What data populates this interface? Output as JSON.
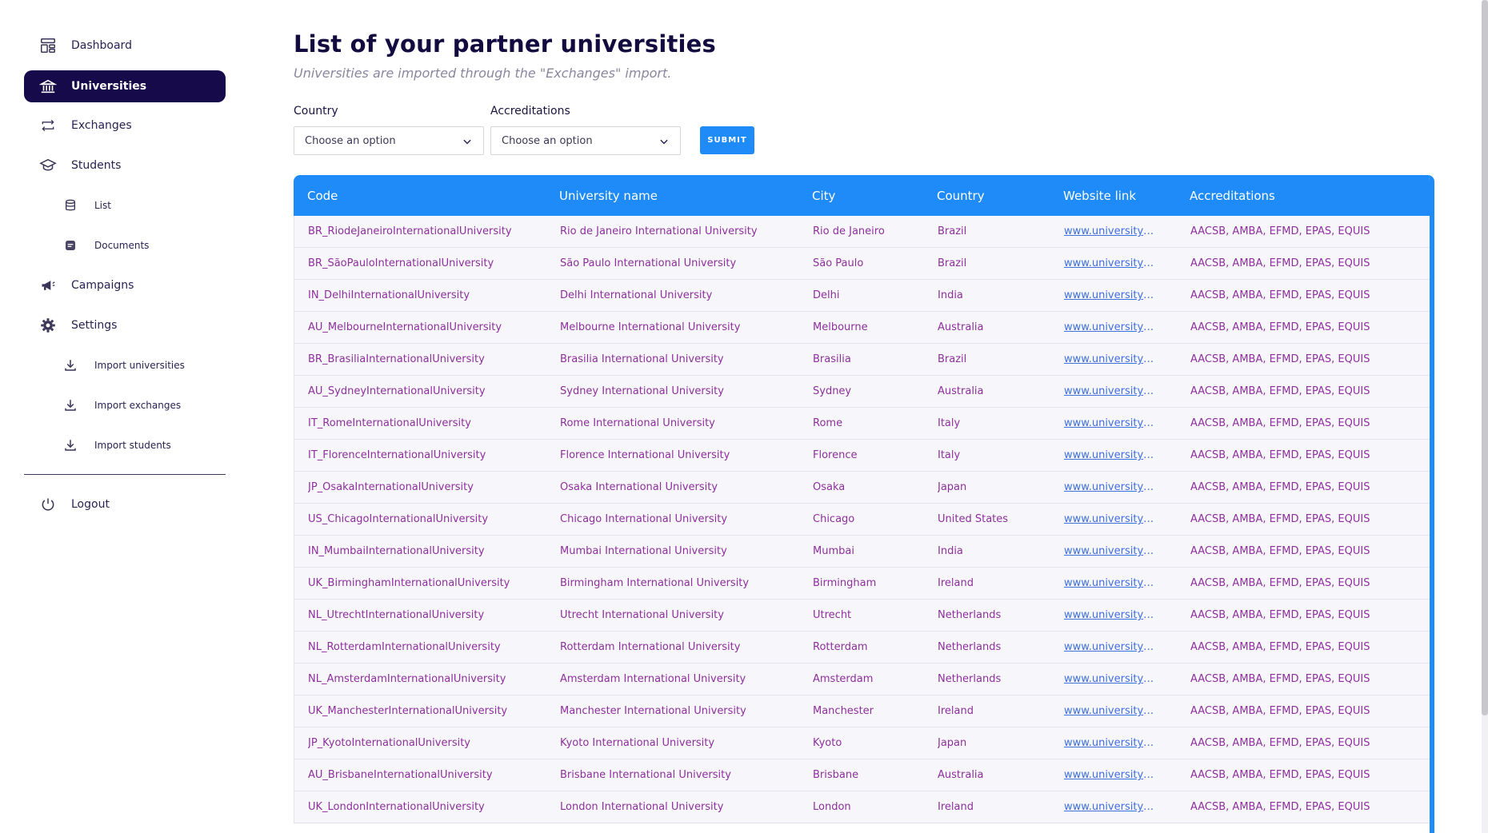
{
  "sidebar": {
    "items": [
      {
        "label": "Dashboard",
        "icon": "dashboard-icon"
      },
      {
        "label": "Universities",
        "icon": "bank-icon",
        "active": true
      },
      {
        "label": "Exchanges",
        "icon": "repeat-icon"
      },
      {
        "label": "Students",
        "icon": "graduation-cap-icon"
      },
      {
        "label": "List",
        "icon": "database-icon"
      },
      {
        "label": "Documents",
        "icon": "document-icon"
      },
      {
        "label": "Campaigns",
        "icon": "megaphone-icon"
      },
      {
        "label": "Settings",
        "icon": "gear-icon"
      },
      {
        "label": "Import universities",
        "icon": "download-icon"
      },
      {
        "label": "Import exchanges",
        "icon": "download-icon"
      },
      {
        "label": "Import students",
        "icon": "download-icon"
      },
      {
        "label": "Logout",
        "icon": "power-icon"
      }
    ]
  },
  "main": {
    "title": "List of your partner universities",
    "subtitle": "Universities are imported through the \"Exchanges\" import.",
    "filters": {
      "country_label": "Country",
      "country_value": "Choose an option",
      "accreditations_label": "Accreditations",
      "accreditations_value": "Choose an option",
      "submit_label": "SUBMIT"
    },
    "table": {
      "headers": [
        "Code",
        "University name",
        "City",
        "Country",
        "Website link",
        "Accreditations"
      ],
      "rows": [
        [
          "BR_RiodeJaneiroInternationalUniversity",
          "Rio de Janeiro International University",
          "Rio de Janeiro",
          "Brazil",
          "www.universitywebsite.com",
          "AACSB, AMBA, EFMD, EPAS, EQUIS"
        ],
        [
          "BR_SãoPauloInternationalUniversity",
          "São Paulo International University",
          "São Paulo",
          "Brazil",
          "www.universitywebsite.com",
          "AACSB, AMBA, EFMD, EPAS, EQUIS"
        ],
        [
          "IN_DelhiInternationalUniversity",
          "Delhi International University",
          "Delhi",
          "India",
          "www.universitywebsite.com",
          "AACSB, AMBA, EFMD, EPAS, EQUIS"
        ],
        [
          "AU_MelbourneInternationalUniversity",
          "Melbourne International University",
          "Melbourne",
          "Australia",
          "www.universitywebsite.com",
          "AACSB, AMBA, EFMD, EPAS, EQUIS"
        ],
        [
          "BR_BrasiliaInternationalUniversity",
          "Brasilia International University",
          "Brasilia",
          "Brazil",
          "www.universitywebsite.com",
          "AACSB, AMBA, EFMD, EPAS, EQUIS"
        ],
        [
          "AU_SydneyInternationalUniversity",
          "Sydney International University",
          "Sydney",
          "Australia",
          "www.universitywebsite.com",
          "AACSB, AMBA, EFMD, EPAS, EQUIS"
        ],
        [
          "IT_RomeInternationalUniversity",
          "Rome International University",
          "Rome",
          "Italy",
          "www.universitywebsite.com",
          "AACSB, AMBA, EFMD, EPAS, EQUIS"
        ],
        [
          "IT_FlorenceInternationalUniversity",
          "Florence International University",
          "Florence",
          "Italy",
          "www.universitywebsite.com",
          "AACSB, AMBA, EFMD, EPAS, EQUIS"
        ],
        [
          "JP_OsakaInternationalUniversity",
          "Osaka International University",
          "Osaka",
          "Japan",
          "www.universitywebsite.com",
          "AACSB, AMBA, EFMD, EPAS, EQUIS"
        ],
        [
          "US_ChicagoInternationalUniversity",
          "Chicago International University",
          "Chicago",
          "United States",
          "www.universitywebsite.com",
          "AACSB, AMBA, EFMD, EPAS, EQUIS"
        ],
        [
          "IN_MumbaiInternationalUniversity",
          "Mumbai International University",
          "Mumbai",
          "India",
          "www.universitywebsite.com",
          "AACSB, AMBA, EFMD, EPAS, EQUIS"
        ],
        [
          "UK_BirminghamInternationalUniversity",
          "Birmingham International University",
          "Birmingham",
          "Ireland",
          "www.universitywebsite.com",
          "AACSB, AMBA, EFMD, EPAS, EQUIS"
        ],
        [
          "NL_UtrechtInternationalUniversity",
          "Utrecht International University",
          "Utrecht",
          "Netherlands",
          "www.universitywebsite.com",
          "AACSB, AMBA, EFMD, EPAS, EQUIS"
        ],
        [
          "NL_RotterdamInternationalUniversity",
          "Rotterdam International University",
          "Rotterdam",
          "Netherlands",
          "www.universitywebsite.com",
          "AACSB, AMBA, EFMD, EPAS, EQUIS"
        ],
        [
          "NL_AmsterdamInternationalUniversity",
          "Amsterdam International University",
          "Amsterdam",
          "Netherlands",
          "www.universitywebsite.com",
          "AACSB, AMBA, EFMD, EPAS, EQUIS"
        ],
        [
          "UK_ManchesterInternationalUniversity",
          "Manchester International University",
          "Manchester",
          "Ireland",
          "www.universitywebsite.com",
          "AACSB, AMBA, EFMD, EPAS, EQUIS"
        ],
        [
          "JP_KyotoInternationalUniversity",
          "Kyoto International University",
          "Kyoto",
          "Japan",
          "www.universitywebsite.com",
          "AACSB, AMBA, EFMD, EPAS, EQUIS"
        ],
        [
          "AU_BrisbaneInternationalUniversity",
          "Brisbane International University",
          "Brisbane",
          "Australia",
          "www.universitywebsite.com",
          "AACSB, AMBA, EFMD, EPAS, EQUIS"
        ],
        [
          "UK_LondonInternationalUniversity",
          "London International University",
          "London",
          "Ireland",
          "www.universitywebsite.com",
          "AACSB, AMBA, EFMD, EPAS, EQUIS"
        ]
      ]
    }
  },
  "colors": {
    "primary": "#1e8bf8",
    "sidebar_active": "#170a4a",
    "cell_text": "#8e2f9d",
    "link": "#3f6fdc"
  }
}
